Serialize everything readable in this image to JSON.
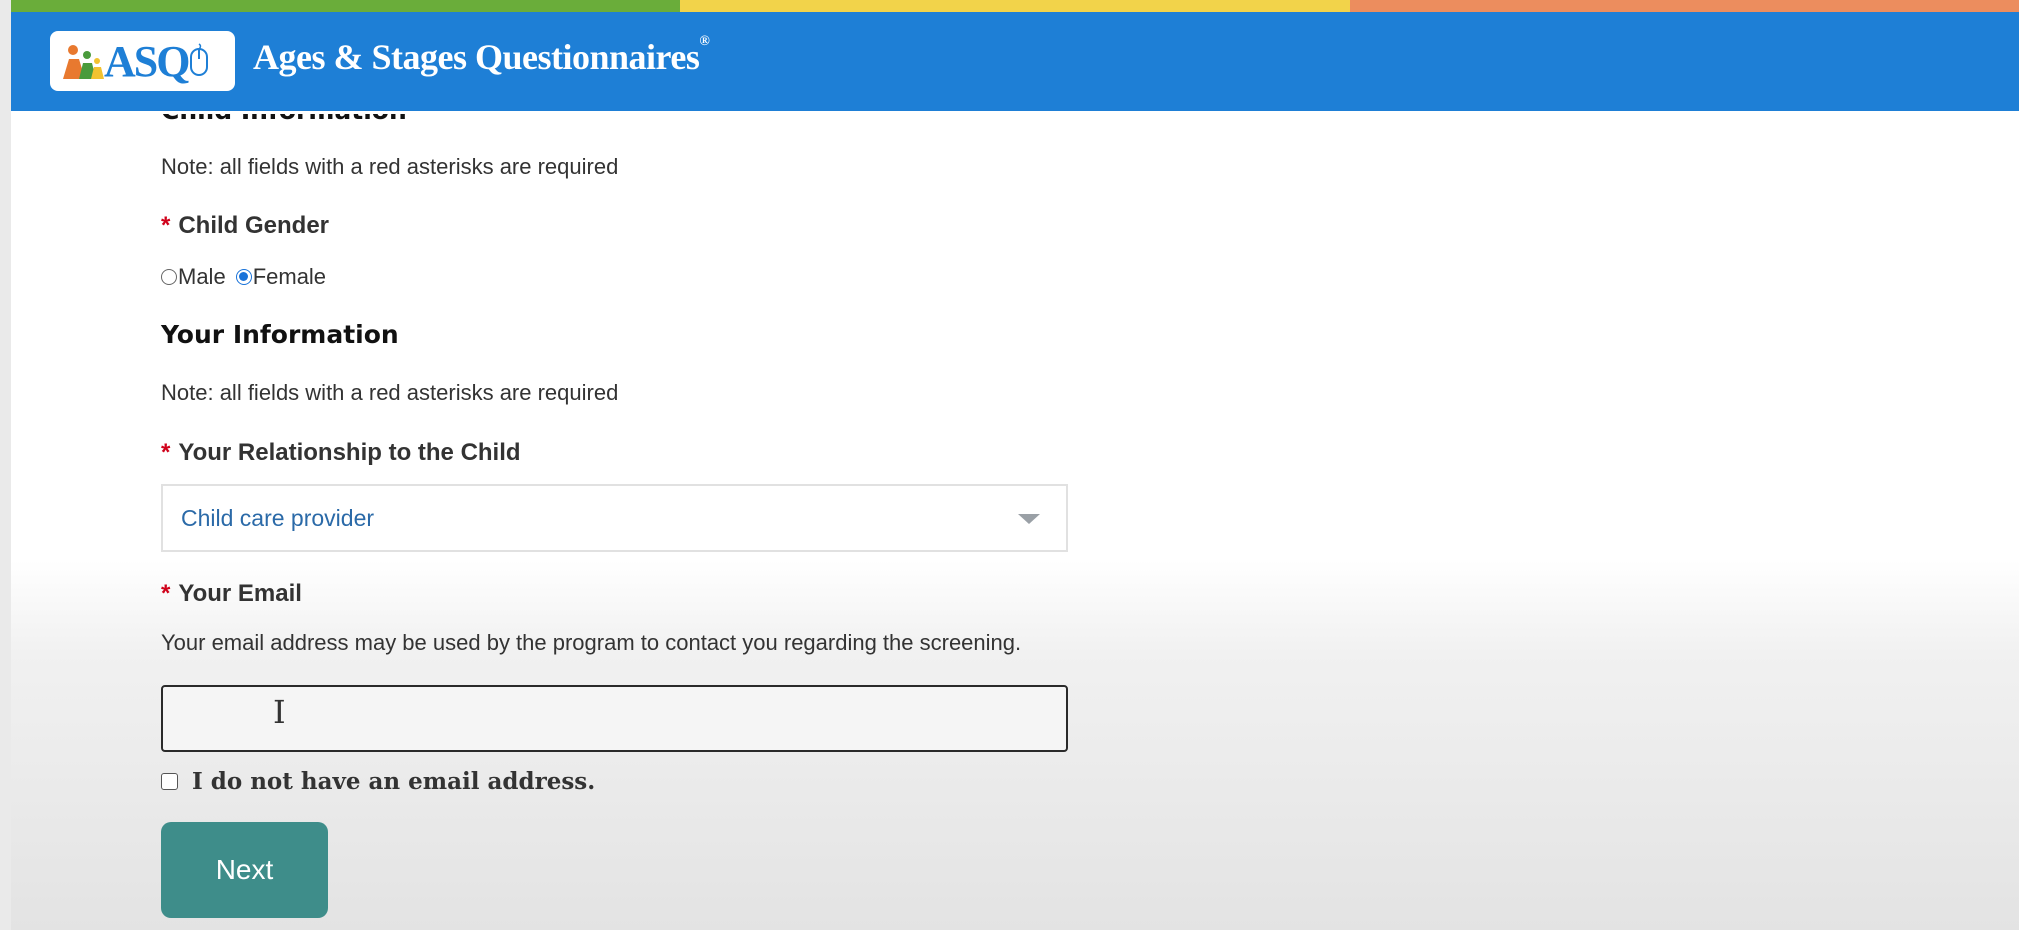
{
  "colors": {
    "header_bg": "#1e7fd6",
    "strip": [
      "#6aad3a",
      "#f2d34a",
      "#ec8d5e"
    ],
    "next_button_bg": "#3e8d8a",
    "required_asterisk": "#d0021b"
  },
  "header": {
    "logo_text": "ASQ",
    "logo_icon": "family-figures-icon",
    "title": "Ages & Stages Questionnaires",
    "title_mark": "®"
  },
  "child_info": {
    "heading": "Child Information",
    "note": "Note: all fields with a red asterisks are required",
    "gender_label": "Child Gender",
    "gender_options": [
      {
        "label": "Male",
        "checked": false
      },
      {
        "label": "Female",
        "checked": true
      }
    ]
  },
  "your_info": {
    "heading": "Your Information",
    "note": "Note: all fields with a red asterisks are required",
    "relationship_label": "Your Relationship to the Child",
    "relationship_value": "Child care provider",
    "email_label": "Your Email",
    "email_help": "Your email address may be used by the program to contact you regarding the screening.",
    "email_value": "",
    "no_email_label": "I do not have an email address.",
    "no_email_checked": false
  },
  "required_mark": "*",
  "next_label": "Next"
}
